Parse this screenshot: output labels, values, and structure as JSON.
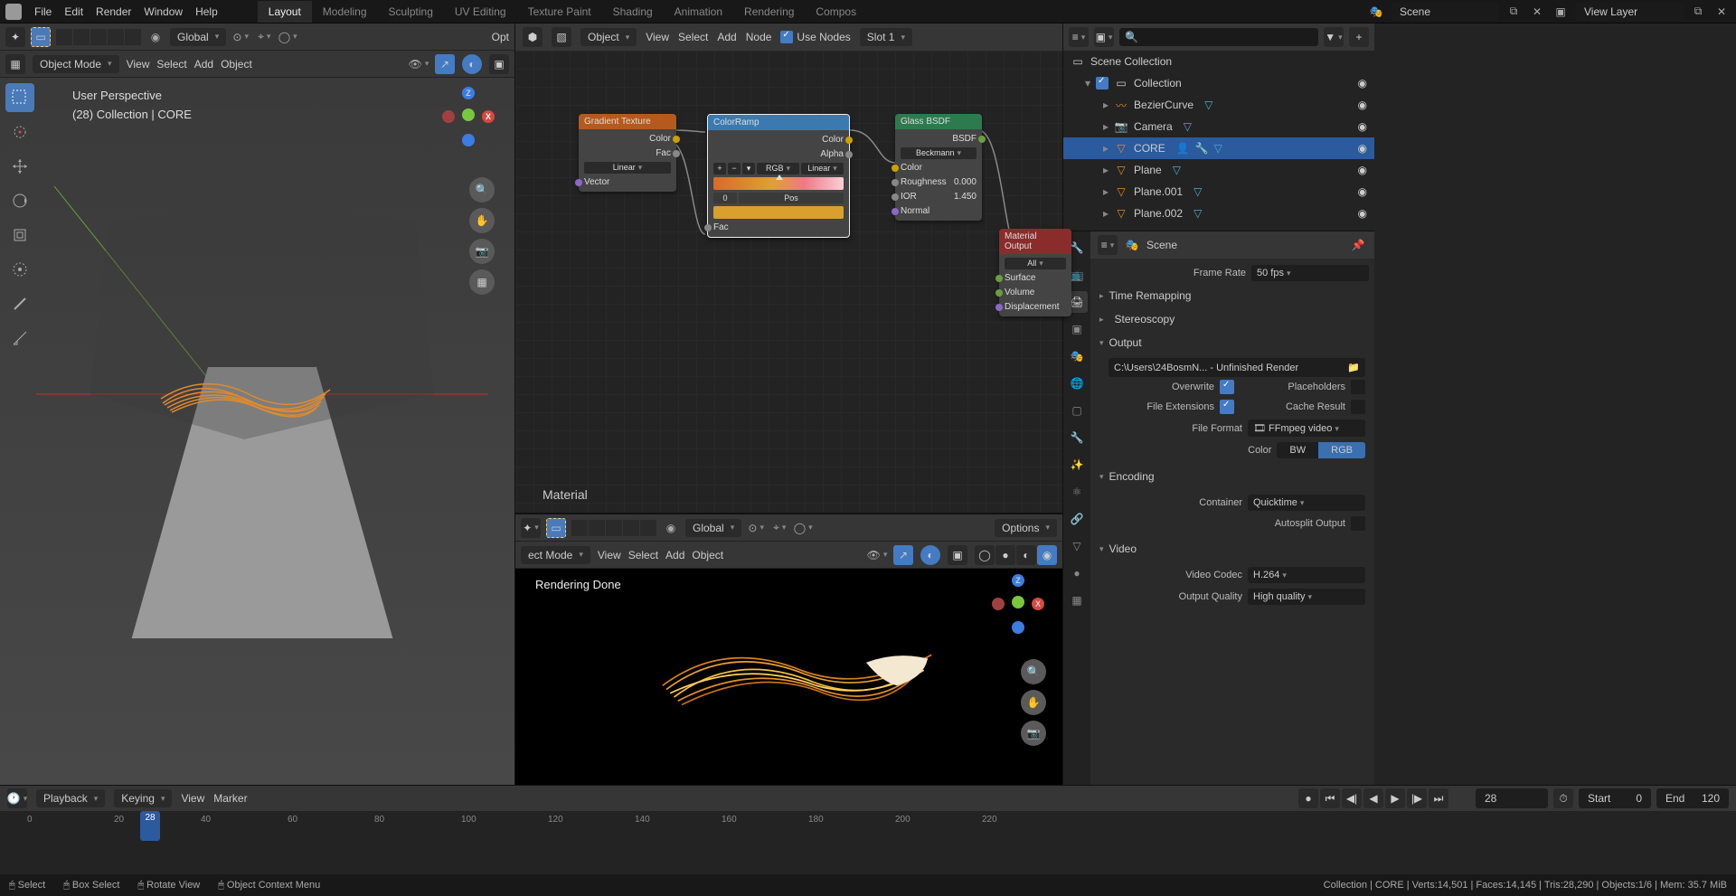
{
  "menus": {
    "file": "File",
    "edit": "Edit",
    "render": "Render",
    "window": "Window",
    "help": "Help"
  },
  "workspaces": [
    "Layout",
    "Modeling",
    "Sculpting",
    "UV Editing",
    "Texture Paint",
    "Shading",
    "Animation",
    "Rendering",
    "Compos"
  ],
  "active_workspace": "Layout",
  "scene_name": "Scene",
  "view_layer": "View Layer",
  "viewport": {
    "mode": "Object Mode",
    "menus": {
      "view": "View",
      "select": "Select",
      "add": "Add",
      "object": "Object"
    },
    "pivot": "Global",
    "info1": "User Perspective",
    "info2": "(28) Collection | CORE",
    "opt": "Opt"
  },
  "node_editor": {
    "type": "Object",
    "menus": {
      "view": "View",
      "select": "Select",
      "add": "Add",
      "node": "Node"
    },
    "use_nodes": "Use Nodes",
    "slot": "Slot 1",
    "material_label": "Material",
    "nodes": {
      "gradient": {
        "title": "Gradient Texture",
        "outputs": [
          "Color",
          "Fac"
        ],
        "interp": "Linear",
        "input": "Vector"
      },
      "colorramp": {
        "title": "ColorRamp",
        "outputs": [
          "Color",
          "Alpha"
        ],
        "mode": "RGB",
        "interp": "Linear",
        "pos_label": "Pos",
        "pos": "0",
        "fac": "Fac"
      },
      "glass": {
        "title": "Glass BSDF",
        "output": "BSDF",
        "dist": "Beckmann",
        "color": "Color",
        "rough_label": "Roughness",
        "rough": "0.000",
        "ior_label": "IOR",
        "ior": "1.450",
        "normal": "Normal"
      },
      "matout": {
        "title": "Material Output",
        "target": "All",
        "surface": "Surface",
        "volume": "Volume",
        "disp": "Displacement"
      }
    }
  },
  "render_viewport": {
    "mode": "ect Mode",
    "menus": {
      "view": "View",
      "select": "Select",
      "add": "Add",
      "object": "Object"
    },
    "options": "Options",
    "status": "Rendering Done",
    "pivot": "Global"
  },
  "outliner": {
    "root": "Scene Collection",
    "collection": "Collection",
    "items": [
      {
        "name": "BezierCurve",
        "type": "curve"
      },
      {
        "name": "Camera",
        "type": "camera"
      },
      {
        "name": "CORE",
        "type": "mesh",
        "sel": true
      },
      {
        "name": "Plane",
        "type": "mesh"
      },
      {
        "name": "Plane.001",
        "type": "mesh"
      },
      {
        "name": "Plane.002",
        "type": "mesh"
      }
    ]
  },
  "properties": {
    "context": "Scene",
    "frame_rate_label": "Frame Rate",
    "frame_rate": "50 fps",
    "time_remap": "Time Remapping",
    "stereo": "Stereoscopy",
    "output": "Output",
    "output_path": "C:\\Users\\24BosmN... - Unfinished Render",
    "overwrite": "Overwrite",
    "placeholders": "Placeholders",
    "file_ext": "File Extensions",
    "cache_result": "Cache Result",
    "file_format_label": "File Format",
    "file_format": "FFmpeg video",
    "color_label": "Color",
    "color_bw": "BW",
    "color_rgb": "RGB",
    "encoding": "Encoding",
    "container_label": "Container",
    "container": "Quicktime",
    "autosplit": "Autosplit Output",
    "video": "Video",
    "codec_label": "Video Codec",
    "codec": "H.264",
    "quality_label": "Output Quality",
    "quality": "High quality"
  },
  "timeline": {
    "playback": "Playback",
    "keying": "Keying",
    "view": "View",
    "marker": "Marker",
    "current": 28,
    "start_label": "Start",
    "start": 0,
    "end_label": "End",
    "end": 120,
    "ticks": [
      0,
      20,
      40,
      60,
      80,
      100,
      120,
      140,
      160,
      180,
      200,
      220
    ]
  },
  "statusbar": {
    "select": "Select",
    "box": "Box Select",
    "rotate": "Rotate View",
    "context": "Object Context Menu",
    "stats": "Collection | CORE | Verts:14,501 | Faces:14,145 | Tris:28,290 | Objects:1/6 | Mem: 35.7 MiB"
  }
}
